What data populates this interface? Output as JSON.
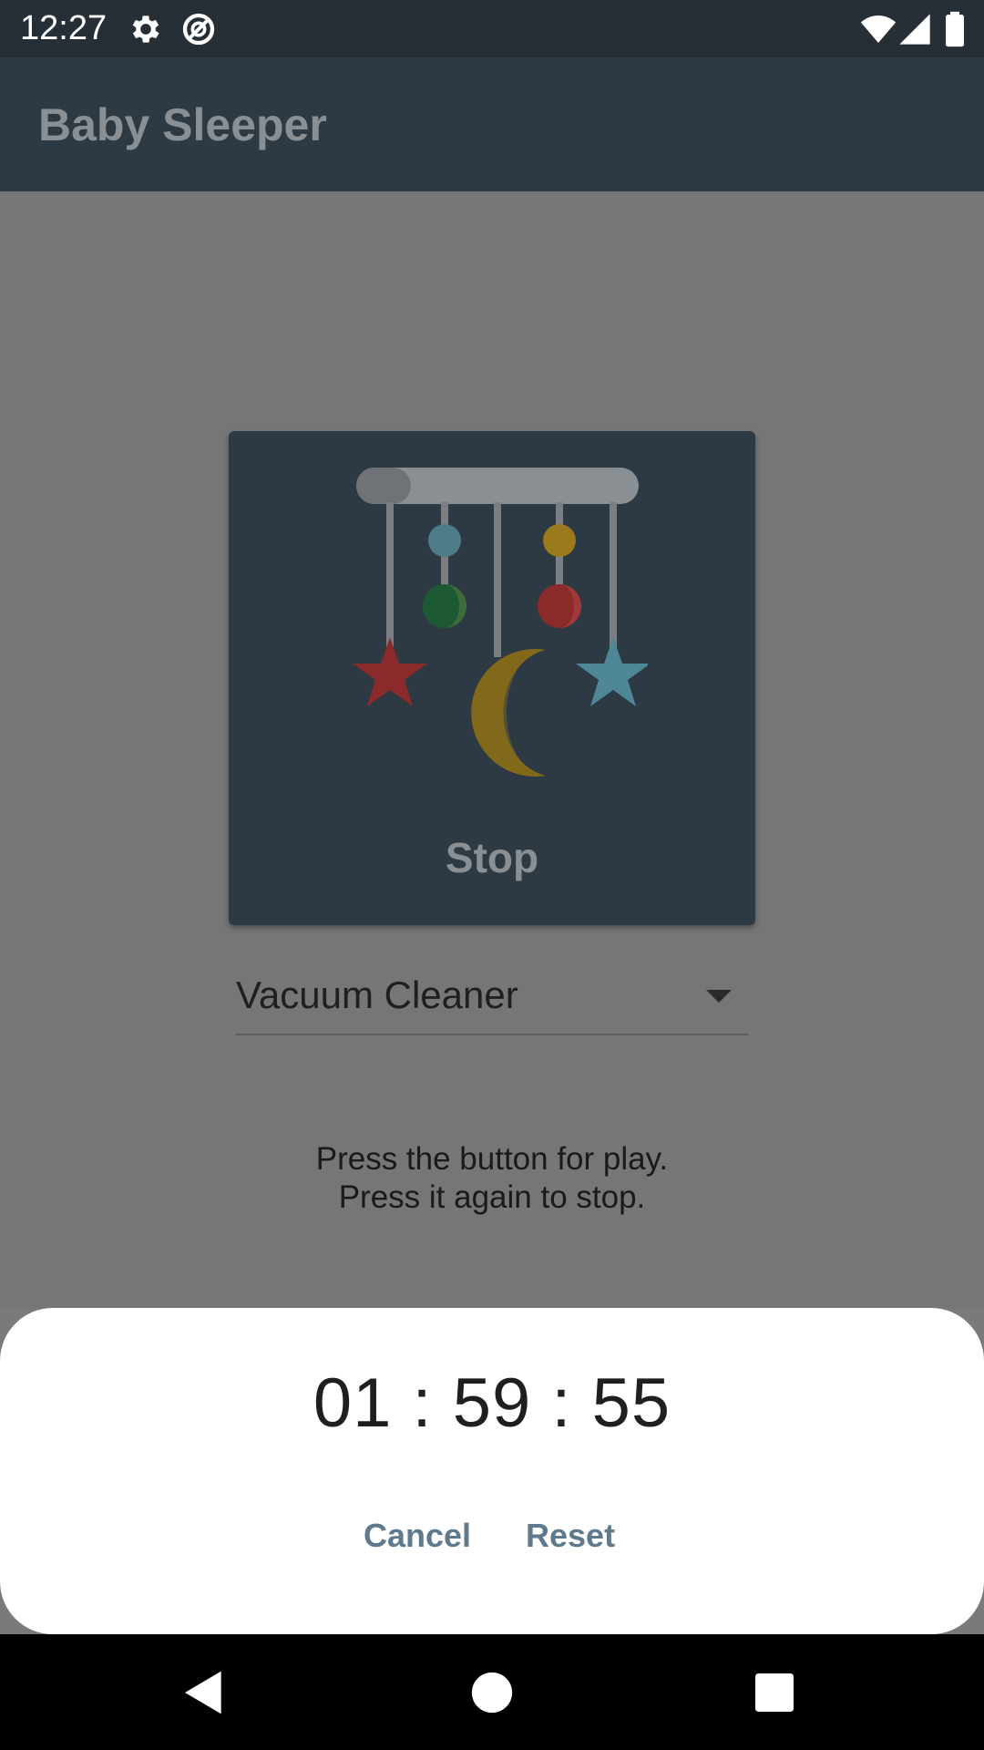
{
  "status_bar": {
    "time": "12:27",
    "icons": [
      "settings-icon",
      "data-saver-icon",
      "wifi-icon",
      "signal-icon",
      "battery-icon"
    ]
  },
  "app_bar": {
    "title": "Baby Sleeper"
  },
  "player": {
    "button_label": "Stop",
    "image": "baby-crib-mobile-illustration"
  },
  "sound_selector": {
    "selected": "Vacuum Cleaner"
  },
  "instructions": {
    "line1": "Press the button for play.",
    "line2": "Press it again to stop."
  },
  "timer_sheet": {
    "time": "01 : 59 : 55",
    "cancel_label": "Cancel",
    "reset_label": "Reset"
  },
  "nav_bar": {
    "icons": [
      "back-icon",
      "home-icon",
      "recents-icon"
    ]
  },
  "colors": {
    "status_bar": "#262f36",
    "app_bar": "#2e3a43",
    "scrim": "#767676",
    "action_text": "#5e7a8c",
    "sheet": "#ffffff"
  }
}
